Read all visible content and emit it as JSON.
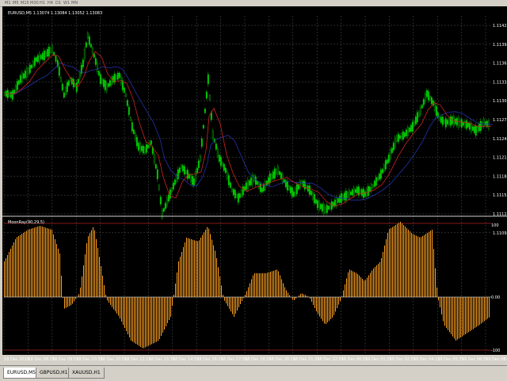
{
  "toolbar": {
    "timeframes": [
      "M1",
      "M5",
      "M15",
      "M30",
      "H1",
      "H4",
      "D1",
      "W1",
      "MN"
    ]
  },
  "chart": {
    "symbol_info": "EURUSD,M5  1.13074 1.13084 1.13052 1.13083",
    "price_labels": [
      "1.11425",
      "1.11395",
      "1.11365",
      "1.11335",
      "1.11305",
      "1.11275",
      "1.11245",
      "1.11215",
      "1.11185",
      "1.11155",
      "1.11125",
      "1.11095"
    ],
    "colors": {
      "background": "#000000",
      "candle_up": "#00cc00",
      "candle_down": "#00aa00",
      "ma_fast": "#cc2222",
      "ma_slow": "#2233aa",
      "grid": "#555555",
      "histogram": "#ffa020",
      "level_line": "#b02020"
    }
  },
  "indicator": {
    "label": "MoonRay(90,29,5)",
    "scale_labels": [
      "100",
      "0.00",
      "-100"
    ]
  },
  "time_axis": {
    "labels": [
      "18 Dec 2019",
      "18 Dec 08:15",
      "18 Dec 09:55",
      "18 Dec 10:35",
      "18 Dec 10:55",
      "18 Dec 12:15",
      "18 Dec 13:35",
      "18 Dec 14:55",
      "18 Dec 16:15",
      "18 Dec 17:35",
      "18 Dec 18:55",
      "18 Dec 20:15",
      "18 Dec 21:35",
      "18 Dec 22:55",
      "19 Dec 00:15",
      "19 Dec 01:35",
      "19 Dec 02:55",
      "19 Dec 04:15",
      "19 Dec 05:35",
      "19 Dec 06:55",
      "19 Dec 08:15"
    ]
  },
  "tabs": [
    {
      "label": "EURUSD,M5",
      "active": true
    },
    {
      "label": "GBPUSD,H1",
      "active": false
    },
    {
      "label": "XAUUSD,H1",
      "active": false
    }
  ]
}
